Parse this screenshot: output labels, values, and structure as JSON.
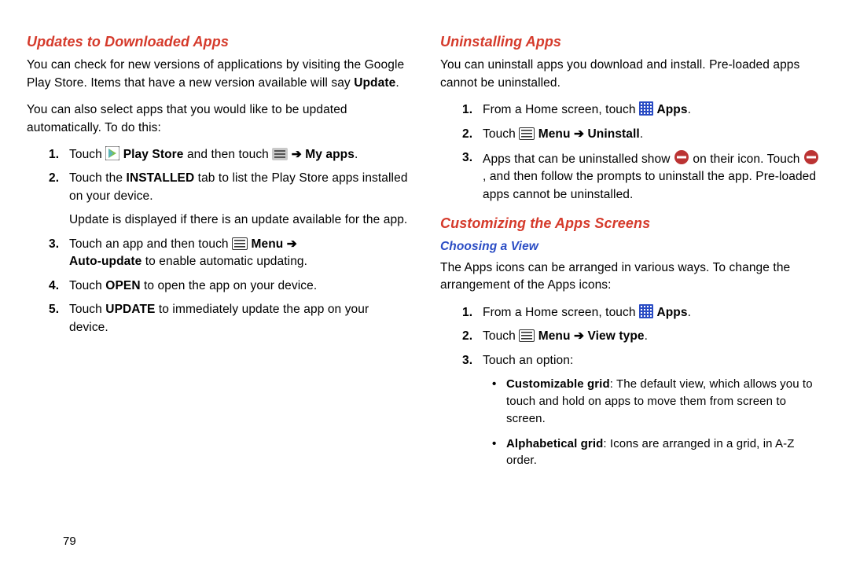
{
  "page_number": "79",
  "left": {
    "heading": "Updates to Downloaded Apps",
    "p1_before_bold": "You can check for new versions of applications by visiting the Google Play Store. Items that have a new version available will say ",
    "p1_bold": "Update",
    "p1_after_bold": ".",
    "p2": "You can also select apps that you would like to be updated automatically. To do this:",
    "steps": {
      "s1": {
        "num": "1.",
        "a": "Touch ",
        "playstore": "Play Store",
        "b": " and then touch ",
        "arrow": " ➔ ",
        "myapps": "My apps",
        "end": "."
      },
      "s2": {
        "num": "2.",
        "a": "Touch the ",
        "installed": "INSTALLED",
        "b": " tab to list the Play Store apps installed on your device.",
        "c": "Update is displayed if there is an update available for the app."
      },
      "s3": {
        "num": "3.",
        "a": "Touch an app and then touch ",
        "menu": "Menu",
        "arrow": " ➔ ",
        "auto": "Auto-update",
        "b": " to enable automatic updating."
      },
      "s4": {
        "num": "4.",
        "a": "Touch ",
        "open": "OPEN",
        "b": " to open the app on your device."
      },
      "s5": {
        "num": "5.",
        "a": "Touch ",
        "update": "UPDATE",
        "b": " to immediately update the app on your device."
      }
    }
  },
  "right": {
    "heading1": "Uninstalling Apps",
    "p1": "You can uninstall apps you download and install. Pre-loaded apps cannot be uninstalled.",
    "u_steps": {
      "s1": {
        "num": "1.",
        "a": "From a Home screen, touch ",
        "apps": "Apps",
        "end": "."
      },
      "s2": {
        "num": "2.",
        "a": "Touch ",
        "menu": "Menu",
        "arrow": " ➔ ",
        "uninstall": "Uninstall",
        "end": "."
      },
      "s3": {
        "num": "3.",
        "a": "Apps that can be uninstalled show ",
        "b": " on their icon. Touch ",
        "c": ", and then follow the prompts to uninstall the app. Pre-loaded apps cannot be uninstalled."
      }
    },
    "heading2": "Customizing the Apps Screens",
    "sub": "Choosing a View",
    "p2": "The Apps icons can be arranged in various ways. To change the arrangement of the Apps icons:",
    "c_steps": {
      "s1": {
        "num": "1.",
        "a": "From a Home screen, touch ",
        "apps": "Apps",
        "end": "."
      },
      "s2": {
        "num": "2.",
        "a": "Touch ",
        "menu": "Menu",
        "arrow": " ➔ ",
        "view": "View type",
        "end": "."
      },
      "s3": {
        "num": "3.",
        "a": "Touch an option:"
      }
    },
    "bullets": {
      "b1": {
        "label": "Customizable grid",
        "text": ": The default view, which allows you to touch and hold on apps to move them from screen to screen."
      },
      "b2": {
        "label": "Alphabetical grid",
        "text": ": Icons are arranged in a grid, in A-Z order."
      }
    }
  }
}
